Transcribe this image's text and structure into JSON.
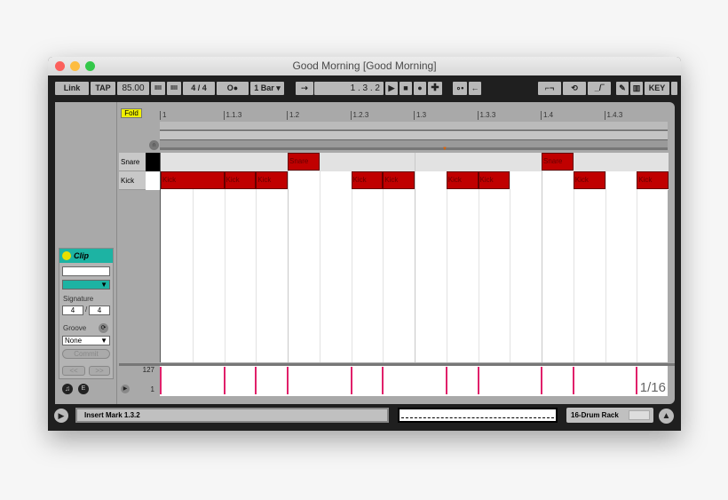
{
  "window": {
    "title": "Good Morning  [Good Morning]"
  },
  "toolbar": {
    "link": "Link",
    "tap": "TAP",
    "tempo": "85.00",
    "nudge_down": "IIII",
    "nudge_up": "IIII",
    "signature": "4  /  4",
    "metronome": "O●",
    "quantize": "1 Bar",
    "follow": "⇢",
    "position": "1 .   3 .   2",
    "key": "KEY"
  },
  "ruler": {
    "labels": [
      "1",
      "1.1.3",
      "1.2",
      "1.2.3",
      "1.3",
      "1.3.3",
      "1.4",
      "1.4.3"
    ]
  },
  "fold_label": "Fold",
  "lanes": [
    {
      "name": "Snare",
      "swatch": "#000000"
    },
    {
      "name": "Kick",
      "swatch": "#ffffff"
    }
  ],
  "clip": {
    "title": "Clip",
    "name": "",
    "color": "#1db3a3",
    "signature_label": "Signature",
    "sig_num": "4",
    "sig_den": "4",
    "groove_label": "Groove",
    "groove_value": "None",
    "commit": "Commit",
    "prev": "<<",
    "next": ">>"
  },
  "velocity": {
    "max": "127",
    "min": "1",
    "grid": "1/16"
  },
  "status": {
    "text": "Insert Mark 1.3.2",
    "device": "16-Drum Rack"
  },
  "chart_data": {
    "type": "piano-roll",
    "unit": "sixteenth",
    "bar_length": 16,
    "notes": [
      {
        "lane": "Snare",
        "label": "Snare",
        "start": 4,
        "length": 1
      },
      {
        "lane": "Snare",
        "label": "Snare",
        "start": 12,
        "length": 1
      },
      {
        "lane": "Kick",
        "label": "Kick",
        "start": 0,
        "length": 2
      },
      {
        "lane": "Kick",
        "label": "Kick",
        "start": 2,
        "length": 1
      },
      {
        "lane": "Kick",
        "label": "Kick",
        "start": 3,
        "length": 1
      },
      {
        "lane": "Kick",
        "label": "Kick",
        "start": 6,
        "length": 1
      },
      {
        "lane": "Kick",
        "label": "Kick",
        "start": 7,
        "length": 1
      },
      {
        "lane": "Kick",
        "label": "Kick",
        "start": 9,
        "length": 1
      },
      {
        "lane": "Kick",
        "label": "Kick",
        "start": 10,
        "length": 1
      },
      {
        "lane": "Kick",
        "label": "Kick",
        "start": 13,
        "length": 1
      },
      {
        "lane": "Kick",
        "label": "Kick",
        "start": 15,
        "length": 1
      }
    ]
  }
}
